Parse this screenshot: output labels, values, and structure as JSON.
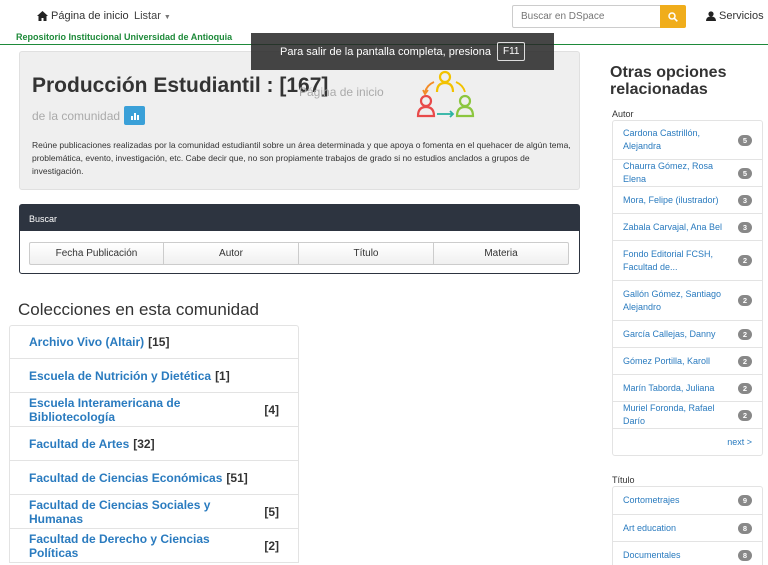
{
  "nav": {
    "home_label": "Página de inicio",
    "list_label": "Listar",
    "search_placeholder": "Buscar en DSpace",
    "services_label": "Servicios",
    "repository_title": "Repositorio Institucional Universidad de Antioquia",
    "icons": {
      "home": "home-icon",
      "search": "search-icon",
      "user": "user-icon"
    },
    "accent_color": "#f0ad1b",
    "brand_color": "#1e8a3a"
  },
  "fullscreen_notice": {
    "text": "Para salir de la pantalla completa, presiona",
    "key": "F11"
  },
  "jumbotron": {
    "title": "Producción Estudiantil : [167]",
    "subtitle_part1": "Página de inicio",
    "subtitle_part2": "de la comunidad",
    "description": "Reúne publicaciones realizadas por la comunidad estudiantil sobre un área determinada y que apoya o fomenta en el quehacer de algún tema, problemática, evento, investigación, etc. Cabe decir que, no son propiamente trabajos de grado si no estudios anclados a grupos de investigación."
  },
  "search_panel": {
    "header": "Buscar",
    "buttons": [
      "Fecha Publicación",
      "Autor",
      "Título",
      "Materia"
    ]
  },
  "collections": {
    "heading": "Colecciones en esta comunidad",
    "items": [
      {
        "name": "Archivo Vivo (Altair)",
        "count": "[15]"
      },
      {
        "name": "Escuela de Nutrición y Dietética",
        "count": "[1]"
      },
      {
        "name": "Escuela Interamericana de Bibliotecología",
        "count": "[4]"
      },
      {
        "name": "Facultad de Artes",
        "count": "[32]"
      },
      {
        "name": "Facultad de Ciencias Económicas",
        "count": "[51]"
      },
      {
        "name": "Facultad de Ciencias Sociales y Humanas",
        "count": "[5]"
      },
      {
        "name": "Facultad de Derecho y Ciencias Políticas",
        "count": "[2]"
      }
    ]
  },
  "sidebar": {
    "heading": "Otras opciones relacionadas",
    "author_label": "Autor",
    "authors": [
      {
        "name": "Cardona Castrillón, Alejandra",
        "count": "5"
      },
      {
        "name": "Chaurra Gómez, Rosa Elena",
        "count": "5"
      },
      {
        "name": "Mora, Felipe (ilustrador)",
        "count": "3"
      },
      {
        "name": "Zabala Carvajal, Ana Bel",
        "count": "3"
      },
      {
        "name": "Fondo Editorial FCSH, Facultad de...",
        "count": "2"
      },
      {
        "name": "Gallón Gómez, Santiago Alejandro",
        "count": "2"
      },
      {
        "name": "García Callejas, Danny",
        "count": "2"
      },
      {
        "name": "Gómez Portilla, Karoll",
        "count": "2"
      },
      {
        "name": "Marín Taborda, Juliana",
        "count": "2"
      },
      {
        "name": "Muriel Foronda, Rafael Darío",
        "count": "2"
      }
    ],
    "next_label": "next >",
    "title_label": "Título",
    "titles": [
      {
        "name": "Cortometrajes",
        "count": "9"
      },
      {
        "name": "Art education",
        "count": "8"
      },
      {
        "name": "Documentales",
        "count": "8"
      }
    ]
  }
}
